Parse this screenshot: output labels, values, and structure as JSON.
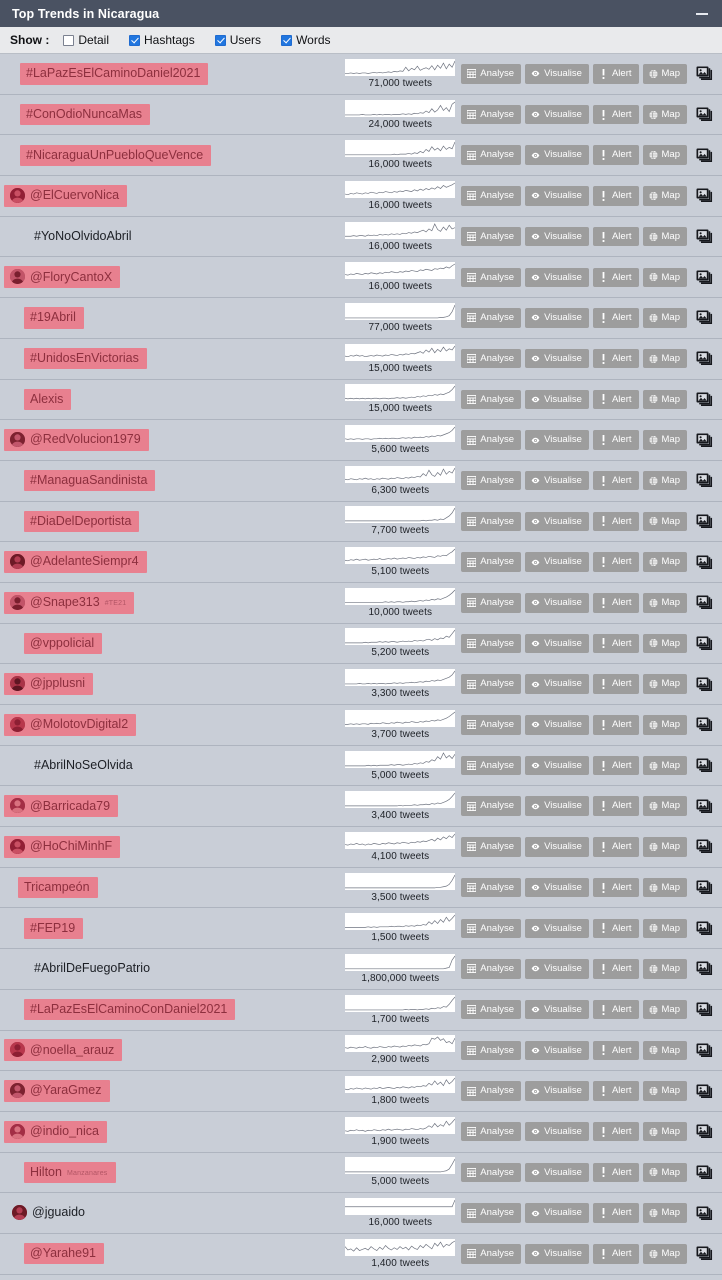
{
  "window": {
    "title": "Top Trends in Nicaragua",
    "minimize_label": "Minimize"
  },
  "filterbar": {
    "show_label": "Show :",
    "options": [
      {
        "label": "Detail",
        "checked": false
      },
      {
        "label": "Hashtags",
        "checked": true
      },
      {
        "label": "Users",
        "checked": true
      },
      {
        "label": "Words",
        "checked": true
      }
    ]
  },
  "colors": {
    "titlebar": "#4a5262",
    "row_background": "#c9ced7",
    "chip_background": "#e8808f",
    "chip_text": "#8d2f3e",
    "button": "#9d9d9d",
    "checkbox_accent": "#2176df"
  },
  "actions": {
    "analyse": "Analyse",
    "visualise": "Visualise",
    "alert": "Alert",
    "map": "Map",
    "images": "Images"
  },
  "units": "tweets",
  "trends": [
    {
      "label": "#LaPazEsElCaminoDaniel2021",
      "type": "hashtag",
      "highlighted": true,
      "avatar": false,
      "count": "71,000 tweets",
      "indent": 20,
      "spark": [
        2,
        2,
        3,
        2,
        3,
        2,
        3,
        3,
        2,
        3,
        4,
        3,
        4,
        3,
        4,
        5,
        4,
        6,
        5,
        7,
        6,
        14,
        7,
        12,
        9,
        16,
        8,
        11,
        13,
        10,
        17,
        9,
        18,
        12,
        22,
        11,
        20,
        14,
        26
      ]
    },
    {
      "label": "#ConOdioNuncaMas",
      "type": "hashtag",
      "highlighted": true,
      "avatar": false,
      "count": "24,000 tweets",
      "indent": 20,
      "spark": [
        1,
        1,
        1,
        1,
        1,
        1,
        2,
        1,
        1,
        1,
        2,
        1,
        2,
        1,
        2,
        2,
        1,
        2,
        2,
        2,
        3,
        2,
        3,
        2,
        4,
        3,
        5,
        4,
        8,
        5,
        12,
        6,
        10,
        18,
        9,
        14,
        7,
        20,
        24
      ]
    },
    {
      "label": "#NicaraguaUnPuebloQueVence",
      "type": "hashtag",
      "highlighted": true,
      "avatar": false,
      "count": "16,000 tweets",
      "indent": 20,
      "spark": [
        1,
        1,
        1,
        1,
        1,
        1,
        1,
        1,
        1,
        1,
        1,
        1,
        1,
        1,
        1,
        1,
        1,
        2,
        1,
        2,
        2,
        2,
        3,
        2,
        4,
        3,
        6,
        4,
        9,
        6,
        13,
        8,
        11,
        7,
        14,
        9,
        12,
        10,
        20
      ]
    },
    {
      "label": "@ElCuervoNica",
      "type": "user",
      "highlighted": true,
      "avatar": true,
      "count": "16,000 tweets",
      "indent": 4,
      "spark": [
        4,
        3,
        5,
        4,
        6,
        5,
        4,
        6,
        5,
        7,
        6,
        5,
        7,
        6,
        8,
        7,
        6,
        8,
        7,
        9,
        8,
        10,
        9,
        8,
        11,
        9,
        12,
        10,
        13,
        11,
        14,
        12,
        16,
        13,
        18,
        15,
        17,
        19,
        22
      ]
    },
    {
      "label": "#YoNoOlvidoAbril",
      "type": "hashtag",
      "highlighted": false,
      "avatar": false,
      "count": "16,000 tweets",
      "indent": 26,
      "spark": [
        2,
        2,
        2,
        3,
        2,
        3,
        3,
        2,
        4,
        3,
        4,
        3,
        5,
        4,
        5,
        4,
        6,
        5,
        6,
        5,
        7,
        6,
        8,
        7,
        9,
        8,
        10,
        12,
        9,
        14,
        11,
        22,
        13,
        10,
        17,
        12,
        20,
        14,
        16
      ]
    },
    {
      "label": "@FloryCantoX",
      "type": "user",
      "highlighted": true,
      "avatar": true,
      "count": "16,000 tweets",
      "indent": 4,
      "spark": [
        5,
        4,
        6,
        5,
        7,
        6,
        5,
        7,
        6,
        8,
        7,
        6,
        8,
        7,
        9,
        8,
        10,
        9,
        8,
        10,
        9,
        11,
        10,
        12,
        11,
        10,
        13,
        12,
        14,
        13,
        12,
        15,
        14,
        16,
        15,
        18,
        16,
        20,
        23
      ]
    },
    {
      "label": "#19Abril",
      "type": "hashtag",
      "highlighted": true,
      "avatar": false,
      "count": "77,000 tweets",
      "indent": 24,
      "spark": [
        1,
        1,
        1,
        1,
        1,
        1,
        1,
        1,
        1,
        1,
        1,
        1,
        1,
        1,
        1,
        1,
        1,
        1,
        1,
        1,
        1,
        1,
        1,
        1,
        1,
        1,
        1,
        1,
        1,
        1,
        1,
        1,
        1,
        2,
        2,
        3,
        5,
        12,
        24
      ]
    },
    {
      "label": "#UnidosEnVictorias",
      "type": "hashtag",
      "highlighted": true,
      "avatar": false,
      "count": "15,000 tweets",
      "indent": 24,
      "spark": [
        6,
        5,
        7,
        6,
        8,
        6,
        7,
        5,
        6,
        7,
        6,
        8,
        7,
        6,
        8,
        7,
        9,
        8,
        7,
        9,
        8,
        10,
        9,
        11,
        10,
        12,
        14,
        11,
        17,
        13,
        20,
        12,
        18,
        14,
        22,
        15,
        19,
        17,
        24
      ]
    },
    {
      "label": "Alexis",
      "type": "word",
      "highlighted": true,
      "avatar": false,
      "count": "15,000 tweets",
      "indent": 24,
      "spark": [
        2,
        1,
        2,
        1,
        2,
        1,
        2,
        1,
        2,
        1,
        2,
        2,
        1,
        2,
        2,
        1,
        2,
        2,
        3,
        2,
        3,
        2,
        3,
        4,
        3,
        5,
        4,
        6,
        5,
        7,
        6,
        8,
        7,
        9,
        8,
        10,
        12,
        16,
        22
      ]
    },
    {
      "label": "@RedVolucion1979",
      "type": "user",
      "highlighted": true,
      "avatar": true,
      "count": "5,600 tweets",
      "indent": 4,
      "spark": [
        3,
        2,
        3,
        2,
        3,
        3,
        2,
        3,
        3,
        2,
        3,
        3,
        4,
        3,
        4,
        3,
        4,
        4,
        3,
        4,
        5,
        4,
        5,
        4,
        6,
        5,
        6,
        5,
        7,
        6,
        8,
        7,
        9,
        8,
        10,
        12,
        14,
        18,
        24
      ]
    },
    {
      "label": "#ManaguaSandinista",
      "type": "hashtag",
      "highlighted": true,
      "avatar": false,
      "count": "6,300 tweets",
      "indent": 24,
      "spark": [
        4,
        3,
        5,
        4,
        3,
        5,
        4,
        6,
        4,
        5,
        3,
        5,
        4,
        6,
        5,
        4,
        6,
        5,
        7,
        6,
        5,
        7,
        6,
        8,
        7,
        9,
        8,
        14,
        10,
        20,
        12,
        9,
        16,
        11,
        22,
        13,
        18,
        15,
        24
      ]
    },
    {
      "label": "#DiaDelDeportista",
      "type": "hashtag",
      "highlighted": true,
      "avatar": false,
      "count": "7,700 tweets",
      "indent": 24,
      "spark": [
        1,
        1,
        1,
        1,
        1,
        1,
        1,
        1,
        1,
        1,
        1,
        1,
        1,
        1,
        1,
        1,
        1,
        1,
        1,
        1,
        1,
        1,
        1,
        1,
        1,
        1,
        1,
        2,
        1,
        2,
        2,
        3,
        2,
        4,
        3,
        6,
        9,
        14,
        22
      ]
    },
    {
      "label": "@AdelanteSiempr4",
      "type": "user",
      "highlighted": true,
      "avatar": true,
      "count": "5,100 tweets",
      "indent": 4,
      "spark": [
        4,
        3,
        5,
        4,
        6,
        4,
        5,
        6,
        4,
        5,
        6,
        5,
        7,
        5,
        6,
        7,
        6,
        8,
        6,
        7,
        8,
        7,
        9,
        8,
        7,
        9,
        8,
        10,
        9,
        11,
        10,
        9,
        12,
        11,
        13,
        12,
        16,
        19,
        24
      ]
    },
    {
      "label": "@Snape313",
      "type": "user",
      "highlighted": true,
      "avatar": true,
      "count": "10,000 tweets",
      "indent": 4,
      "sub": "#TE21",
      "spark": [
        2,
        2,
        2,
        2,
        2,
        2,
        2,
        2,
        2,
        2,
        2,
        2,
        2,
        2,
        3,
        2,
        3,
        2,
        3,
        3,
        2,
        3,
        3,
        4,
        3,
        4,
        5,
        4,
        6,
        5,
        7,
        6,
        8,
        7,
        9,
        11,
        14,
        18,
        23
      ]
    },
    {
      "label": "@vppolicial",
      "type": "user",
      "highlighted": true,
      "avatar": false,
      "count": "5,200 tweets",
      "indent": 24,
      "spark": [
        1,
        1,
        1,
        1,
        1,
        1,
        1,
        2,
        1,
        2,
        2,
        2,
        3,
        2,
        3,
        2,
        3,
        3,
        2,
        3,
        4,
        3,
        4,
        3,
        5,
        4,
        5,
        4,
        6,
        7,
        5,
        8,
        6,
        9,
        8,
        12,
        10,
        16,
        22
      ]
    },
    {
      "label": "@jpplusni",
      "type": "user",
      "highlighted": true,
      "avatar": true,
      "count": "3,300 tweets",
      "indent": 4,
      "spark": [
        1,
        1,
        1,
        1,
        1,
        2,
        1,
        1,
        2,
        1,
        2,
        1,
        2,
        2,
        1,
        2,
        2,
        3,
        2,
        3,
        2,
        3,
        3,
        4,
        3,
        4,
        5,
        4,
        6,
        5,
        7,
        6,
        8,
        7,
        9,
        11,
        13,
        17,
        24
      ]
    },
    {
      "label": "@MolotovDigital2",
      "type": "user",
      "highlighted": true,
      "avatar": true,
      "count": "3,700 tweets",
      "indent": 4,
      "spark": [
        2,
        2,
        3,
        2,
        3,
        2,
        3,
        3,
        2,
        4,
        3,
        4,
        3,
        5,
        4,
        3,
        5,
        4,
        6,
        5,
        4,
        6,
        5,
        7,
        6,
        5,
        7,
        6,
        8,
        7,
        9,
        8,
        10,
        9,
        11,
        13,
        16,
        20,
        24
      ]
    },
    {
      "label": "#AbrilNoSeOlvida",
      "type": "hashtag",
      "highlighted": false,
      "avatar": false,
      "count": "5,000 tweets",
      "indent": 26,
      "spark": [
        1,
        1,
        1,
        1,
        1,
        1,
        1,
        1,
        2,
        1,
        2,
        1,
        2,
        2,
        2,
        2,
        3,
        2,
        3,
        3,
        2,
        3,
        4,
        3,
        5,
        4,
        6,
        5,
        8,
        7,
        11,
        9,
        16,
        12,
        22,
        14,
        18,
        13,
        20
      ]
    },
    {
      "label": "@Barricada79",
      "type": "user",
      "highlighted": true,
      "avatar": true,
      "count": "3,400 tweets",
      "indent": 4,
      "spark": [
        1,
        1,
        1,
        1,
        1,
        1,
        1,
        1,
        1,
        1,
        1,
        1,
        1,
        1,
        1,
        1,
        1,
        1,
        1,
        2,
        1,
        2,
        2,
        2,
        3,
        2,
        3,
        3,
        4,
        3,
        5,
        4,
        6,
        5,
        7,
        9,
        12,
        17,
        23
      ]
    },
    {
      "label": "@HoChiMinhF",
      "type": "user",
      "highlighted": true,
      "avatar": true,
      "count": "4,100 tweets",
      "indent": 4,
      "spark": [
        5,
        4,
        6,
        5,
        7,
        5,
        6,
        4,
        6,
        5,
        7,
        6,
        5,
        7,
        6,
        8,
        7,
        6,
        8,
        7,
        9,
        8,
        7,
        9,
        8,
        10,
        9,
        11,
        10,
        12,
        14,
        11,
        16,
        13,
        18,
        15,
        20,
        17,
        23
      ]
    },
    {
      "label": "Tricampeón",
      "type": "word",
      "highlighted": true,
      "avatar": false,
      "count": "3,500 tweets",
      "indent": 18,
      "spark": [
        1,
        1,
        1,
        1,
        1,
        1,
        1,
        1,
        1,
        1,
        1,
        1,
        1,
        1,
        1,
        1,
        1,
        1,
        1,
        1,
        1,
        1,
        1,
        1,
        1,
        1,
        1,
        1,
        1,
        1,
        1,
        1,
        2,
        2,
        3,
        4,
        7,
        14,
        23
      ]
    },
    {
      "label": "#FEP19",
      "type": "hashtag",
      "highlighted": true,
      "avatar": false,
      "count": "1,500 tweets",
      "indent": 24,
      "spark": [
        2,
        2,
        2,
        2,
        2,
        2,
        2,
        2,
        3,
        2,
        3,
        2,
        3,
        3,
        3,
        3,
        4,
        3,
        4,
        4,
        3,
        5,
        4,
        5,
        4,
        6,
        5,
        7,
        6,
        12,
        8,
        14,
        9,
        16,
        11,
        20,
        13,
        18,
        24
      ]
    },
    {
      "label": "#AbrilDeFuegoPatrio",
      "type": "hashtag",
      "highlighted": false,
      "avatar": false,
      "count": "1,800,000 tweets",
      "indent": 26,
      "spark": [
        1,
        1,
        1,
        1,
        1,
        1,
        1,
        1,
        1,
        1,
        1,
        1,
        1,
        1,
        1,
        1,
        1,
        1,
        1,
        1,
        1,
        1,
        1,
        1,
        1,
        1,
        1,
        1,
        1,
        1,
        1,
        1,
        1,
        1,
        1,
        2,
        3,
        14,
        20
      ]
    },
    {
      "label": "#LaPazEsElCaminoConDaniel2021",
      "type": "hashtag",
      "highlighted": true,
      "avatar": false,
      "count": "1,700 tweets",
      "indent": 24,
      "spark": [
        1,
        1,
        1,
        1,
        1,
        1,
        1,
        1,
        1,
        1,
        1,
        1,
        1,
        1,
        1,
        1,
        1,
        1,
        1,
        1,
        1,
        2,
        1,
        2,
        2,
        1,
        2,
        2,
        3,
        2,
        4,
        3,
        5,
        4,
        7,
        6,
        11,
        18,
        24
      ]
    },
    {
      "label": "@noella_arauz",
      "type": "user",
      "highlighted": true,
      "avatar": true,
      "count": "2,900 tweets",
      "indent": 4,
      "spark": [
        5,
        4,
        6,
        5,
        4,
        6,
        5,
        7,
        5,
        4,
        6,
        5,
        7,
        6,
        5,
        7,
        6,
        8,
        7,
        6,
        8,
        7,
        9,
        8,
        10,
        9,
        8,
        11,
        10,
        12,
        22,
        20,
        24,
        18,
        21,
        14,
        16,
        12,
        22
      ]
    },
    {
      "label": "@YaraGmez",
      "type": "user",
      "highlighted": true,
      "avatar": true,
      "count": "1,800 tweets",
      "indent": 4,
      "spark": [
        4,
        3,
        5,
        4,
        6,
        5,
        4,
        6,
        5,
        4,
        6,
        5,
        7,
        5,
        6,
        7,
        6,
        5,
        7,
        6,
        8,
        7,
        6,
        8,
        7,
        9,
        8,
        10,
        9,
        14,
        11,
        18,
        12,
        16,
        10,
        20,
        13,
        17,
        23
      ]
    },
    {
      "label": "@indio_nica",
      "type": "user",
      "highlighted": true,
      "avatar": true,
      "count": "1,900 tweets",
      "indent": 4,
      "spark": [
        3,
        2,
        4,
        3,
        5,
        3,
        4,
        2,
        4,
        3,
        5,
        4,
        3,
        5,
        4,
        6,
        4,
        5,
        6,
        5,
        4,
        6,
        5,
        7,
        6,
        5,
        7,
        6,
        8,
        12,
        9,
        16,
        10,
        14,
        11,
        20,
        13,
        18,
        24
      ]
    },
    {
      "label": "Hilton",
      "type": "word",
      "highlighted": true,
      "avatar": false,
      "count": "5,000 tweets",
      "indent": 24,
      "sub": "Manzanares",
      "spark": [
        1,
        1,
        1,
        1,
        1,
        1,
        1,
        1,
        1,
        1,
        1,
        1,
        1,
        1,
        1,
        1,
        1,
        1,
        1,
        1,
        1,
        1,
        1,
        1,
        1,
        1,
        1,
        1,
        1,
        1,
        1,
        1,
        1,
        1,
        2,
        3,
        6,
        14,
        23
      ]
    },
    {
      "label": "@jguaido",
      "type": "user",
      "highlighted": false,
      "avatar": true,
      "count": "16,000 tweets",
      "indent": 4,
      "spark": [
        1,
        1,
        1,
        1,
        1,
        1,
        1,
        1,
        1,
        1,
        1,
        1,
        1,
        1,
        1,
        1,
        1,
        1,
        1,
        1,
        1,
        1,
        1,
        1,
        1,
        1,
        1,
        1,
        1,
        1,
        1,
        1,
        1,
        1,
        1,
        1,
        1,
        1,
        2
      ]
    },
    {
      "label": "@Yarahe91",
      "type": "user",
      "highlighted": true,
      "avatar": false,
      "count": "1,400 tweets",
      "indent": 24,
      "spark": [
        14,
        8,
        10,
        6,
        12,
        7,
        9,
        11,
        8,
        14,
        10,
        7,
        13,
        9,
        16,
        11,
        8,
        12,
        9,
        14,
        10,
        13,
        8,
        15,
        11,
        9,
        16,
        12,
        18,
        14,
        10,
        20,
        15,
        22,
        13,
        18,
        16,
        21,
        24
      ]
    }
  ]
}
